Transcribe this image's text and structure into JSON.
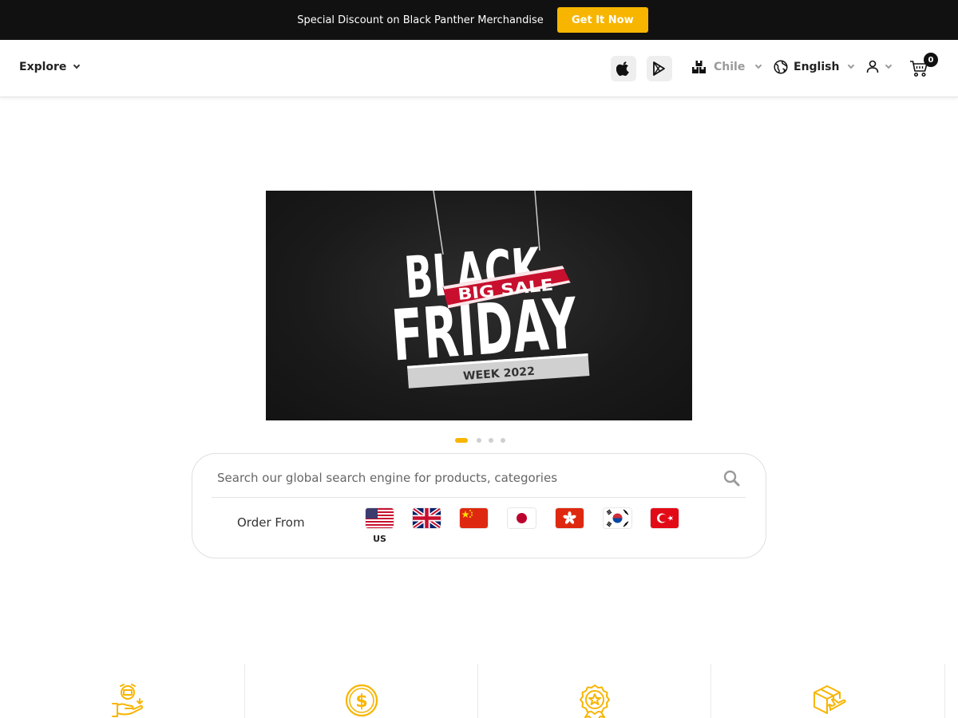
{
  "promo": {
    "text": "Special Discount on Black Panther Merchandise",
    "button_label": "Get It Now",
    "accent_color": "#f7b500"
  },
  "header": {
    "explore_label": "Explore",
    "app_store_icon": "apple-icon",
    "play_store_icon": "google-play-icon",
    "country": {
      "icon": "warehouse-icon",
      "label": "Chile"
    },
    "language": {
      "icon": "globe-icon",
      "label": "English"
    },
    "account_icon": "user-icon",
    "cart": {
      "icon": "cart-icon",
      "count": "0"
    }
  },
  "banner": {
    "lines": [
      "BLACK",
      "BIG SALE",
      "FRIDAY",
      "WEEK 2022"
    ],
    "slide_count": 4,
    "active_slide": 1
  },
  "search": {
    "placeholder": "Search our global search engine for products, categories",
    "value": "",
    "order_from_label": "Order From",
    "countries": [
      {
        "flag": "us-flag-icon",
        "label": "US",
        "selected": true
      },
      {
        "flag": "uk-flag-icon",
        "label": "",
        "selected": false
      },
      {
        "flag": "china-flag-icon",
        "label": "",
        "selected": false
      },
      {
        "flag": "japan-flag-icon",
        "label": "",
        "selected": false
      },
      {
        "flag": "hong-kong-flag-icon",
        "label": "",
        "selected": false
      },
      {
        "flag": "south-korea-flag-icon",
        "label": "",
        "selected": false
      },
      {
        "flag": "turkey-flag-icon",
        "label": "",
        "selected": false
      }
    ]
  },
  "features": [
    {
      "icon": "hand-money-icon"
    },
    {
      "icon": "dollar-coin-icon"
    },
    {
      "icon": "award-badge-icon"
    },
    {
      "icon": "plane-box-icon"
    }
  ]
}
